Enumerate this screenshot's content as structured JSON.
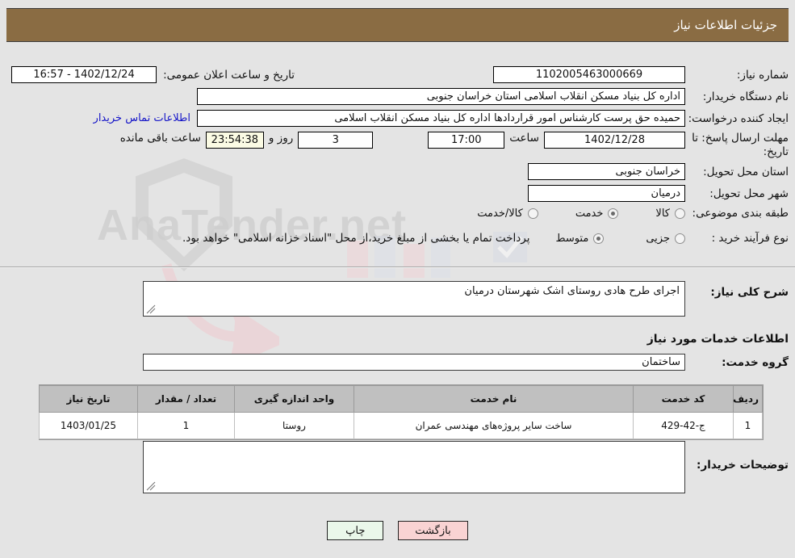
{
  "header": {
    "title": "جزئیات اطلاعات نیاز",
    "bg_color": "#8a6c43",
    "text_color": "#ffffff"
  },
  "form": {
    "need_number_label": "شماره نیاز:",
    "need_number_value": "1102005463000669",
    "announce_datetime_label": "تاریخ و ساعت اعلان عمومی:",
    "announce_datetime_value": "16:57 - 1402/12/24",
    "buyer_org_label": "نام دستگاه خریدار:",
    "buyer_org_value": "اداره کل بنیاد مسکن انقلاب اسلامی استان خراسان جنوبی",
    "creator_label": "ایجاد کننده درخواست:",
    "creator_value": "حمیده حق پرست کارشناس امور قراردادها اداره کل بنیاد مسکن انقلاب اسلامی",
    "contact_link": "اطلاعات تماس خریدار",
    "contact_link_color": "#1414c8",
    "deadline_label": "مهلت ارسال پاسخ: تا تاریخ:",
    "deadline_date": "1402/12/28",
    "deadline_time_label": "ساعت",
    "deadline_time": "17:00",
    "remaining_days": "3",
    "remaining_days_suffix": "روز و",
    "remaining_clock": "23:54:38",
    "remaining_clock_suffix": "ساعت باقی مانده",
    "province_label": "استان محل تحویل:",
    "province_value": "خراسان جنوبی",
    "city_label": "شهر محل تحویل:",
    "city_value": "درمیان",
    "category_label": "طبقه بندی موضوعی:",
    "category_options": [
      {
        "label": "کالا",
        "selected": false
      },
      {
        "label": "خدمت",
        "selected": true
      },
      {
        "label": "کالا/خدمت",
        "selected": false
      }
    ],
    "purchase_type_label": "نوع فرآیند خرید :",
    "purchase_type_options": [
      {
        "label": "جزیی",
        "selected": false
      },
      {
        "label": "متوسط",
        "selected": true
      }
    ],
    "payment_note": "پرداخت تمام یا بخشی از مبلغ خرید،از محل \"اسناد خزانه اسلامی\" خواهد بود."
  },
  "description": {
    "label": "شرح کلی نیاز:",
    "value": "اجرای طرح هادی روستای اشک شهرستان درمیان"
  },
  "services": {
    "section_title": "اطلاعات خدمات مورد نیاز",
    "group_label": "گروه خدمت:",
    "group_value": "ساختمان",
    "columns": [
      "ردیف",
      "کد خدمت",
      "نام خدمت",
      "واحد اندازه گیری",
      "تعداد / مقدار",
      "تاریخ نیاز"
    ],
    "rows": [
      {
        "index": "1",
        "code": "ج-42-429",
        "name": "ساخت سایر پروژه‌های مهندسی عمران",
        "unit": "روستا",
        "quantity": "1",
        "need_date": "1403/01/25"
      }
    ]
  },
  "buyer_comments": {
    "label": "توضیحات خریدار:",
    "value": ""
  },
  "buttons": {
    "print": "چاپ",
    "back": "بازگشت",
    "print_color": "#eaf7ea",
    "back_color": "#f9d3d3"
  },
  "watermark": {
    "text": "AnaTender.net"
  }
}
